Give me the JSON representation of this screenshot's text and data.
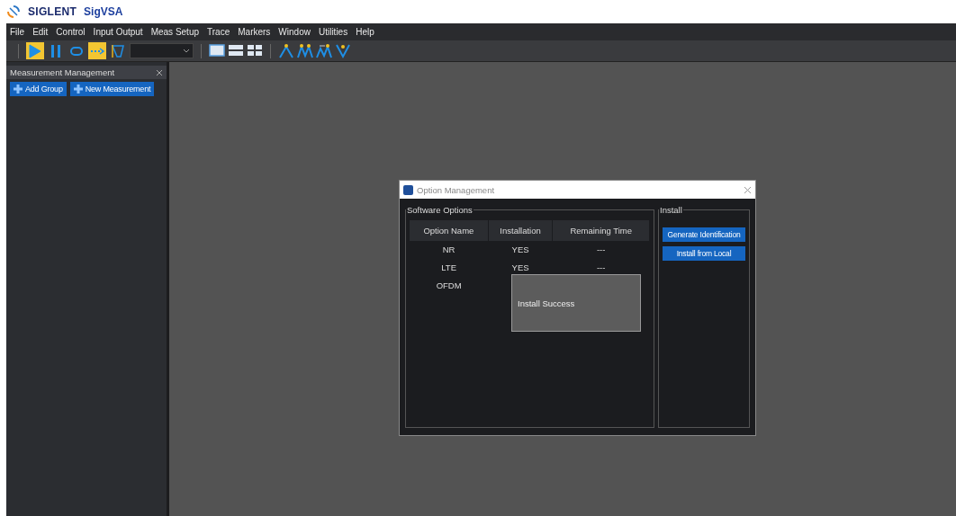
{
  "app": {
    "brand": "SIGLENT",
    "title": "SigVSA"
  },
  "menu": [
    "File",
    "Edit",
    "Control",
    "Input Output",
    "Meas Setup",
    "Trace",
    "Markers",
    "Window",
    "Utilities",
    "Help"
  ],
  "toolbar": {
    "buttons": [
      {
        "kind": "play",
        "selected": true
      },
      {
        "kind": "pause",
        "selected": false
      },
      {
        "kind": "loop",
        "selected": false
      },
      {
        "kind": "sweep",
        "selected": true
      },
      {
        "kind": "span",
        "selected": false
      }
    ],
    "layouts": [
      {
        "kind": "single"
      },
      {
        "kind": "split"
      },
      {
        "kind": "quad"
      }
    ],
    "markers": [
      {
        "kind": "peak"
      },
      {
        "kind": "next-peak"
      },
      {
        "kind": "peak-right"
      },
      {
        "kind": "min"
      }
    ]
  },
  "panel": {
    "title": "Measurement Management",
    "buttons": [
      "Add Group",
      "New Measurement"
    ]
  },
  "dialog": {
    "title": "Option Management",
    "software_options": {
      "title": "Software Options",
      "columns": [
        "Option Name",
        "Installation",
        "Remaining Time"
      ],
      "rows": [
        {
          "option_name": "NR",
          "installation": "YES",
          "remaining_time": "---"
        },
        {
          "option_name": "LTE",
          "installation": "YES",
          "remaining_time": "---"
        },
        {
          "option_name": "OFDM"
        }
      ]
    },
    "install": {
      "title": "Install",
      "buttons": [
        "Generate Identification",
        "Install from Local"
      ]
    },
    "message": "Install Success"
  }
}
